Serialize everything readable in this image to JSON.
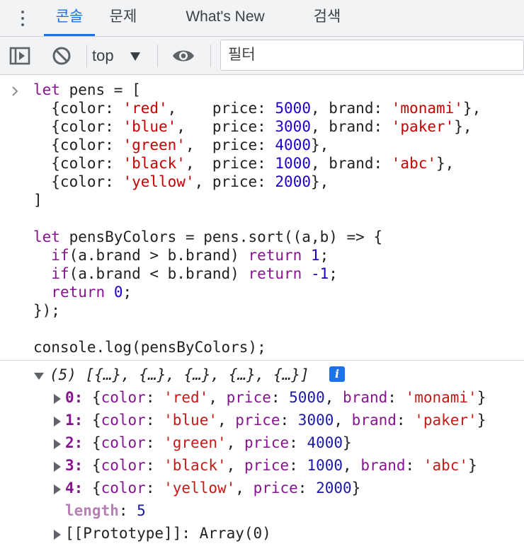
{
  "tabs": [
    {
      "label": "콘솔",
      "active": true
    },
    {
      "label": "문제"
    },
    {
      "label": "What's New"
    },
    {
      "label": "검색"
    }
  ],
  "toolbar": {
    "context": "top",
    "filter_placeholder": "필터",
    "icons": [
      "sidebar-toggle-icon",
      "clear-console-icon",
      "eye-icon"
    ]
  },
  "code": {
    "l1": {
      "a": "let",
      "b": " pens = ["
    },
    "pens": [
      {
        "c": "'red'",
        "pad": ",    ",
        "p": "5000",
        "b": "'monami'",
        "end": "},"
      },
      {
        "c": "'blue'",
        "pad": ",   ",
        "p": "3000",
        "b": "'paker'",
        "end": "},"
      },
      {
        "c": "'green'",
        "pad": ",  ",
        "p": "4000",
        "end": "},"
      },
      {
        "c": "'black'",
        "pad": ",  ",
        "p": "1000",
        "b": "'abc'",
        "end": "},"
      },
      {
        "c": "'yellow'",
        "pad": ", ",
        "p": "2000",
        "end": "},"
      }
    ],
    "close": "]",
    "sort1": {
      "a": "let",
      "b": " pensByColors = pens.sort((a,b) => {"
    },
    "sort2": {
      "a": "if",
      "b": "(a.brand > b.brand) ",
      "c": "return",
      "d": "1",
      "e": ";"
    },
    "sort3": {
      "a": "if",
      "b": "(a.brand < b.brand) ",
      "c": "return",
      "d": "-1",
      "e": ";"
    },
    "sort4": {
      "a": "return",
      "d": "0",
      "e": ";"
    },
    "sort5": "});",
    "log": "console.log(pensByColors);"
  },
  "output": {
    "summary": "(5) [{…}, {…}, {…}, {…}, {…}]",
    "info": "i",
    "items": [
      {
        "i": "0",
        "c": "'red'",
        "p": "5000",
        "b": "'monami'"
      },
      {
        "i": "1",
        "c": "'blue'",
        "p": "3000",
        "b": "'paker'"
      },
      {
        "i": "2",
        "c": "'green'",
        "p": "4000"
      },
      {
        "i": "3",
        "c": "'black'",
        "p": "1000",
        "b": "'abc'"
      },
      {
        "i": "4",
        "c": "'yellow'",
        "p": "2000"
      }
    ],
    "length_key": "length",
    "length_val": "5",
    "proto": "[[Prototype]]: Array(0)"
  },
  "colors": {
    "accent": "#1a73e8",
    "keyword": "#881391",
    "string": "#c80000",
    "number": "#1c00cf"
  }
}
